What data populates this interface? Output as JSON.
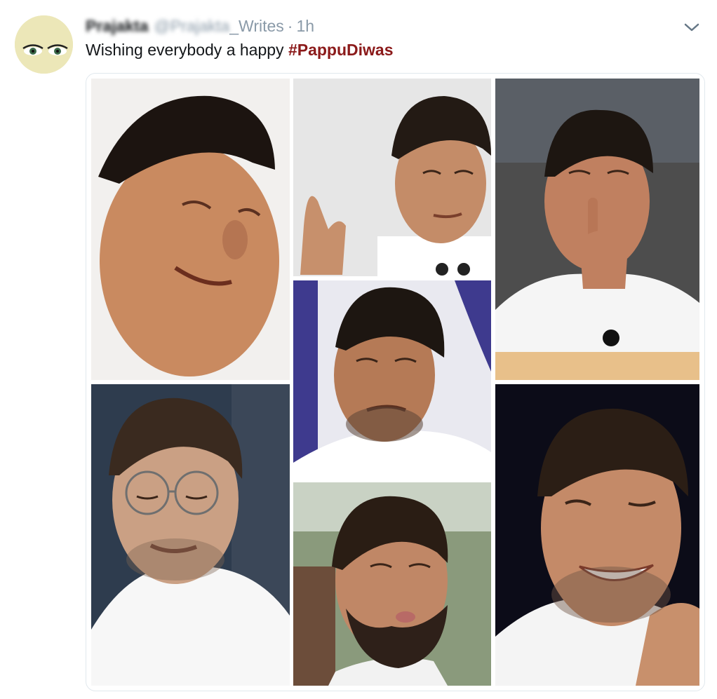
{
  "tweet": {
    "display_name": "Prajakta",
    "handle_visible": "_Writes",
    "handle_blurred": "@Prajakta",
    "separator": "·",
    "time": "1h",
    "text_prefix": "Wishing everybody a happy ",
    "hashtag": "#PappuDiwas"
  },
  "colors": {
    "hashtag": "#8b1a1a",
    "meta": "#8a9aa8",
    "text": "#14171a"
  },
  "icons": {
    "more": "chevron-down-icon"
  },
  "media": {
    "photo_count": 7
  }
}
